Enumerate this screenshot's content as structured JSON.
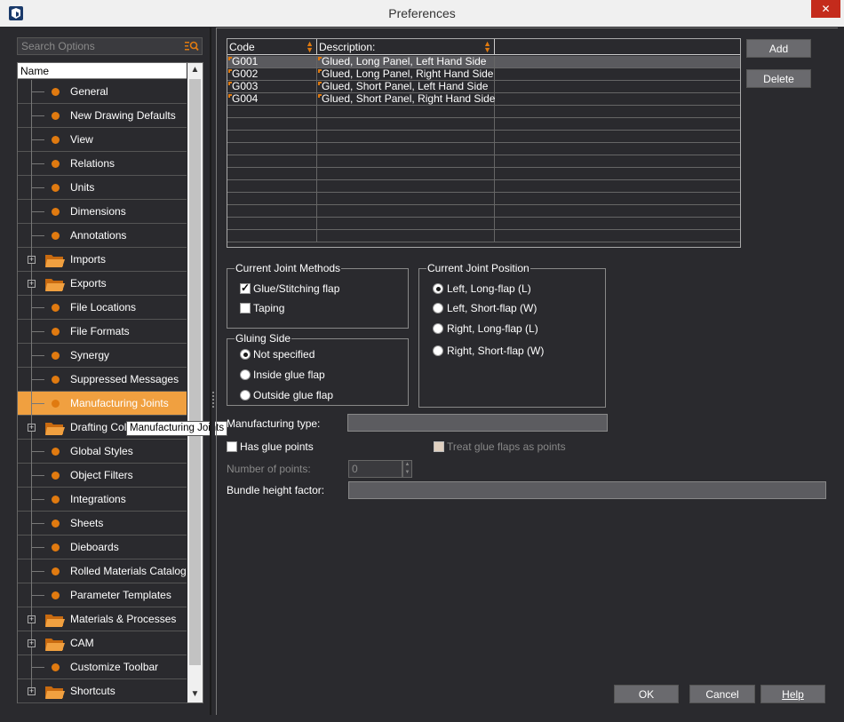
{
  "window": {
    "title": "Preferences",
    "close_glyph": "✕"
  },
  "search": {
    "placeholder": "Search Options",
    "icon": "search-icon"
  },
  "tree": {
    "header": "Name",
    "tooltip": "Manufacturing Joints",
    "items": [
      {
        "label": "General",
        "type": "leaf"
      },
      {
        "label": "New Drawing Defaults",
        "type": "leaf"
      },
      {
        "label": "View",
        "type": "leaf"
      },
      {
        "label": "Relations",
        "type": "leaf"
      },
      {
        "label": "Units",
        "type": "leaf"
      },
      {
        "label": "Dimensions",
        "type": "leaf"
      },
      {
        "label": "Annotations",
        "type": "leaf"
      },
      {
        "label": "Imports",
        "type": "folder"
      },
      {
        "label": "Exports",
        "type": "folder"
      },
      {
        "label": "File Locations",
        "type": "leaf"
      },
      {
        "label": "File Formats",
        "type": "leaf"
      },
      {
        "label": "Synergy",
        "type": "leaf"
      },
      {
        "label": "Suppressed Messages",
        "type": "leaf"
      },
      {
        "label": "Manufacturing Joints",
        "type": "leaf",
        "selected": true
      },
      {
        "label": "Drafting Colors",
        "type": "folder"
      },
      {
        "label": "Global Styles",
        "type": "leaf"
      },
      {
        "label": "Object Filters",
        "type": "leaf"
      },
      {
        "label": "Integrations",
        "type": "leaf"
      },
      {
        "label": "Sheets",
        "type": "leaf"
      },
      {
        "label": "Dieboards",
        "type": "leaf"
      },
      {
        "label": "Rolled Materials Catalog",
        "type": "leaf"
      },
      {
        "label": "Parameter Templates",
        "type": "leaf"
      },
      {
        "label": "Materials & Processes",
        "type": "folder"
      },
      {
        "label": "CAM",
        "type": "folder"
      },
      {
        "label": "Customize Toolbar",
        "type": "leaf"
      },
      {
        "label": "Shortcuts",
        "type": "folder"
      }
    ]
  },
  "grid": {
    "columns": [
      "Code",
      "Description:"
    ],
    "rows": [
      {
        "code": "G001",
        "description": "Glued, Long Panel, Left Hand Side",
        "selected": true
      },
      {
        "code": "G002",
        "description": "Glued, Long Panel, Right Hand Side"
      },
      {
        "code": "G003",
        "description": "Glued, Short Panel, Left Hand Side"
      },
      {
        "code": "G004",
        "description": "Glued, Short Panel, Right Hand Side"
      }
    ]
  },
  "buttons": {
    "add": "Add",
    "delete": "Delete",
    "ok": "OK",
    "cancel": "Cancel",
    "help": "Help"
  },
  "joint_methods": {
    "title": "Current Joint Methods",
    "options": [
      {
        "label": "Glue/Stitching flap",
        "checked": true
      },
      {
        "label": "Taping",
        "checked": false
      }
    ]
  },
  "gluing_side": {
    "title": "Gluing Side",
    "options": [
      {
        "label": "Not specified",
        "checked": true
      },
      {
        "label": "Inside glue flap",
        "checked": false
      },
      {
        "label": "Outside glue flap",
        "checked": false
      }
    ]
  },
  "joint_position": {
    "title": "Current Joint Position",
    "options": [
      {
        "label": "Left, Long-flap (L)",
        "checked": true
      },
      {
        "label": "Left, Short-flap (W)",
        "checked": false
      },
      {
        "label": "Right, Long-flap (L)",
        "checked": false
      },
      {
        "label": "Right, Short-flap (W)",
        "checked": false
      }
    ]
  },
  "form": {
    "manufacturing_type_label": "Manufacturing type:",
    "manufacturing_type_value": "",
    "has_glue_points_label": "Has glue points",
    "treat_glue_flaps_label": "Treat glue flaps as points",
    "number_of_points_label": "Number of points:",
    "number_of_points_value": "0",
    "bundle_height_label": "Bundle height factor:",
    "bundle_height_value": ""
  }
}
